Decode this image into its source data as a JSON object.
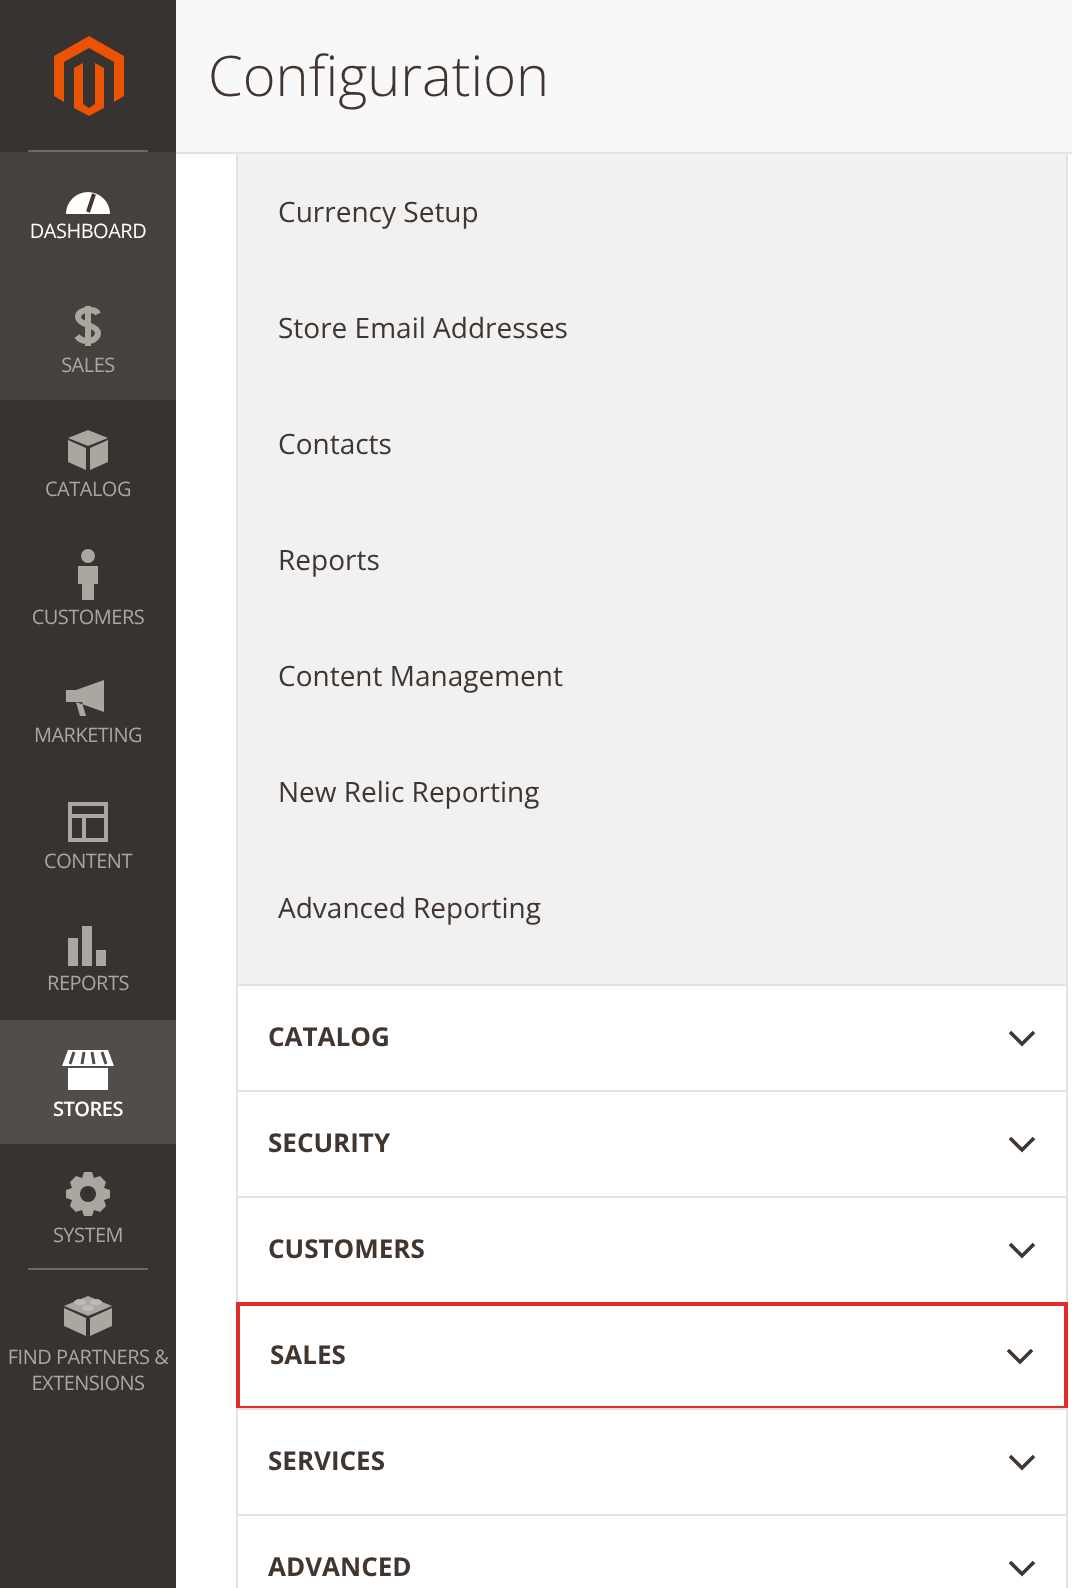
{
  "page_title": "Configuration",
  "sidebar": {
    "items": [
      {
        "label": "DASHBOARD",
        "selected": false,
        "hovered": true,
        "bright": true
      },
      {
        "label": "SALES",
        "selected": false,
        "hovered": true,
        "bright": false
      },
      {
        "label": "CATALOG",
        "selected": false,
        "hovered": false,
        "bright": false
      },
      {
        "label": "CUSTOMERS",
        "selected": false,
        "hovered": false,
        "bright": false
      },
      {
        "label": "MARKETING",
        "selected": false,
        "hovered": false,
        "bright": false
      },
      {
        "label": "CONTENT",
        "selected": false,
        "hovered": false,
        "bright": false
      },
      {
        "label": "REPORTS",
        "selected": false,
        "hovered": false,
        "bright": false
      },
      {
        "label": "STORES",
        "selected": true,
        "hovered": false,
        "bright": true
      },
      {
        "label": "SYSTEM",
        "selected": false,
        "hovered": false,
        "bright": false
      }
    ],
    "extra": {
      "label": "FIND PARTNERS & EXTENSIONS"
    }
  },
  "submenu": [
    "Currency Setup",
    "Store Email Addresses",
    "Contacts",
    "Reports",
    "Content Management",
    "New Relic Reporting",
    "Advanced Reporting"
  ],
  "sections": [
    {
      "label": "CATALOG",
      "highlighted": false
    },
    {
      "label": "SECURITY",
      "highlighted": false
    },
    {
      "label": "CUSTOMERS",
      "highlighted": false
    },
    {
      "label": "SALES",
      "highlighted": true
    },
    {
      "label": "SERVICES",
      "highlighted": false
    },
    {
      "label": "ADVANCED",
      "highlighted": false
    }
  ]
}
